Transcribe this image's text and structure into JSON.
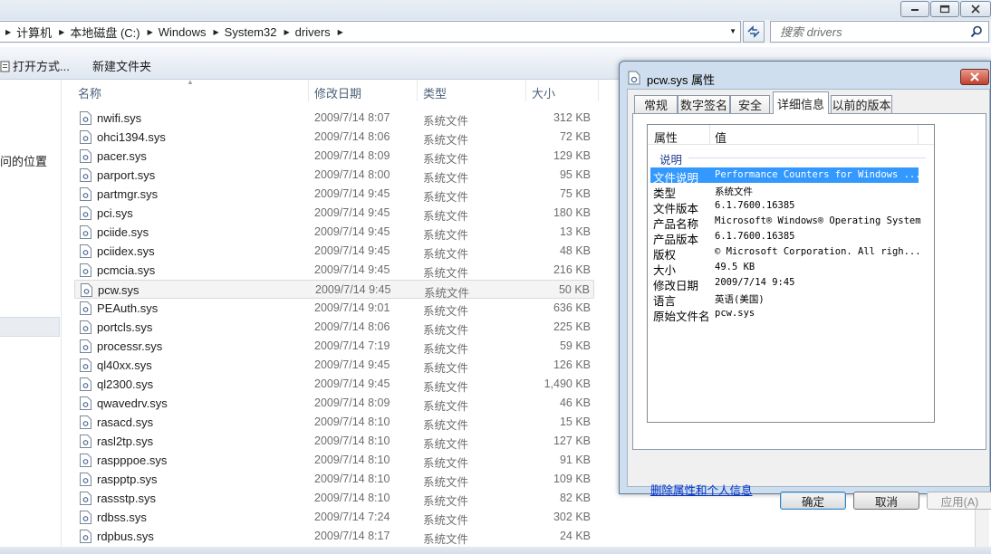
{
  "window": {
    "controls": [
      "minimize-icon",
      "maximize-icon",
      "close-icon"
    ]
  },
  "address": {
    "crumbs": [
      "计算机",
      "本地磁盘 (C:)",
      "Windows",
      "System32",
      "drivers"
    ],
    "search_placeholder": "搜索 drivers"
  },
  "toolbar": {
    "open_with": "打开方式...",
    "new_folder": "新建文件夹"
  },
  "nav": {
    "recent_label": "问的位置"
  },
  "file_list": {
    "columns": {
      "name": "名称",
      "date": "修改日期",
      "type": "类型",
      "size": "大小"
    },
    "rows": [
      {
        "name": "nwifi.sys",
        "date": "2009/7/14 8:07",
        "type": "系统文件",
        "size": "312 KB"
      },
      {
        "name": "ohci1394.sys",
        "date": "2009/7/14 8:06",
        "type": "系统文件",
        "size": "72 KB"
      },
      {
        "name": "pacer.sys",
        "date": "2009/7/14 8:09",
        "type": "系统文件",
        "size": "129 KB"
      },
      {
        "name": "parport.sys",
        "date": "2009/7/14 8:00",
        "type": "系统文件",
        "size": "95 KB"
      },
      {
        "name": "partmgr.sys",
        "date": "2009/7/14 9:45",
        "type": "系统文件",
        "size": "75 KB"
      },
      {
        "name": "pci.sys",
        "date": "2009/7/14 9:45",
        "type": "系统文件",
        "size": "180 KB"
      },
      {
        "name": "pciide.sys",
        "date": "2009/7/14 9:45",
        "type": "系统文件",
        "size": "13 KB"
      },
      {
        "name": "pciidex.sys",
        "date": "2009/7/14 9:45",
        "type": "系统文件",
        "size": "48 KB"
      },
      {
        "name": "pcmcia.sys",
        "date": "2009/7/14 9:45",
        "type": "系统文件",
        "size": "216 KB"
      },
      {
        "name": "pcw.sys",
        "date": "2009/7/14 9:45",
        "type": "系统文件",
        "size": "50 KB",
        "selected": true
      },
      {
        "name": "PEAuth.sys",
        "date": "2009/7/14 9:01",
        "type": "系统文件",
        "size": "636 KB"
      },
      {
        "name": "portcls.sys",
        "date": "2009/7/14 8:06",
        "type": "系统文件",
        "size": "225 KB"
      },
      {
        "name": "processr.sys",
        "date": "2009/7/14 7:19",
        "type": "系统文件",
        "size": "59 KB"
      },
      {
        "name": "ql40xx.sys",
        "date": "2009/7/14 9:45",
        "type": "系统文件",
        "size": "126 KB"
      },
      {
        "name": "ql2300.sys",
        "date": "2009/7/14 9:45",
        "type": "系统文件",
        "size": "1,490 KB"
      },
      {
        "name": "qwavedrv.sys",
        "date": "2009/7/14 8:09",
        "type": "系统文件",
        "size": "46 KB"
      },
      {
        "name": "rasacd.sys",
        "date": "2009/7/14 8:10",
        "type": "系统文件",
        "size": "15 KB"
      },
      {
        "name": "rasl2tp.sys",
        "date": "2009/7/14 8:10",
        "type": "系统文件",
        "size": "127 KB"
      },
      {
        "name": "raspppoe.sys",
        "date": "2009/7/14 8:10",
        "type": "系统文件",
        "size": "91 KB"
      },
      {
        "name": "raspptp.sys",
        "date": "2009/7/14 8:10",
        "type": "系统文件",
        "size": "109 KB"
      },
      {
        "name": "rassstp.sys",
        "date": "2009/7/14 8:10",
        "type": "系统文件",
        "size": "82 KB"
      },
      {
        "name": "rdbss.sys",
        "date": "2009/7/14 7:24",
        "type": "系统文件",
        "size": "302 KB"
      },
      {
        "name": "rdpbus.sys",
        "date": "2009/7/14 8:17",
        "type": "系统文件",
        "size": "24 KB"
      }
    ]
  },
  "dialog": {
    "title": "pcw.sys 属性",
    "tabs": [
      "常规",
      "数字签名",
      "安全",
      "详细信息",
      "以前的版本"
    ],
    "active_tab": "详细信息",
    "table_headers": {
      "property": "属性",
      "value": "值"
    },
    "group_label": "说明",
    "properties": [
      {
        "key": "文件说明",
        "value": "Performance Counters for Windows ...",
        "selected": true
      },
      {
        "key": "类型",
        "value": "系统文件"
      },
      {
        "key": "文件版本",
        "value": "6.1.7600.16385"
      },
      {
        "key": "产品名称",
        "value": "Microsoft® Windows® Operating System"
      },
      {
        "key": "产品版本",
        "value": "6.1.7600.16385"
      },
      {
        "key": "版权",
        "value": "© Microsoft Corporation. All righ..."
      },
      {
        "key": "大小",
        "value": "49.5 KB"
      },
      {
        "key": "修改日期",
        "value": "2009/7/14 9:45"
      },
      {
        "key": "语言",
        "value": "英语(美国)"
      },
      {
        "key": "原始文件名",
        "value": "pcw.sys"
      }
    ],
    "remove_link": "删除属性和个人信息",
    "buttons": {
      "ok": "确定",
      "cancel": "取消",
      "apply": "应用(A)"
    }
  },
  "colors": {
    "selection_blue": "#3399ff",
    "link_blue": "#0033cc",
    "group_blue": "#1e3c8c"
  }
}
